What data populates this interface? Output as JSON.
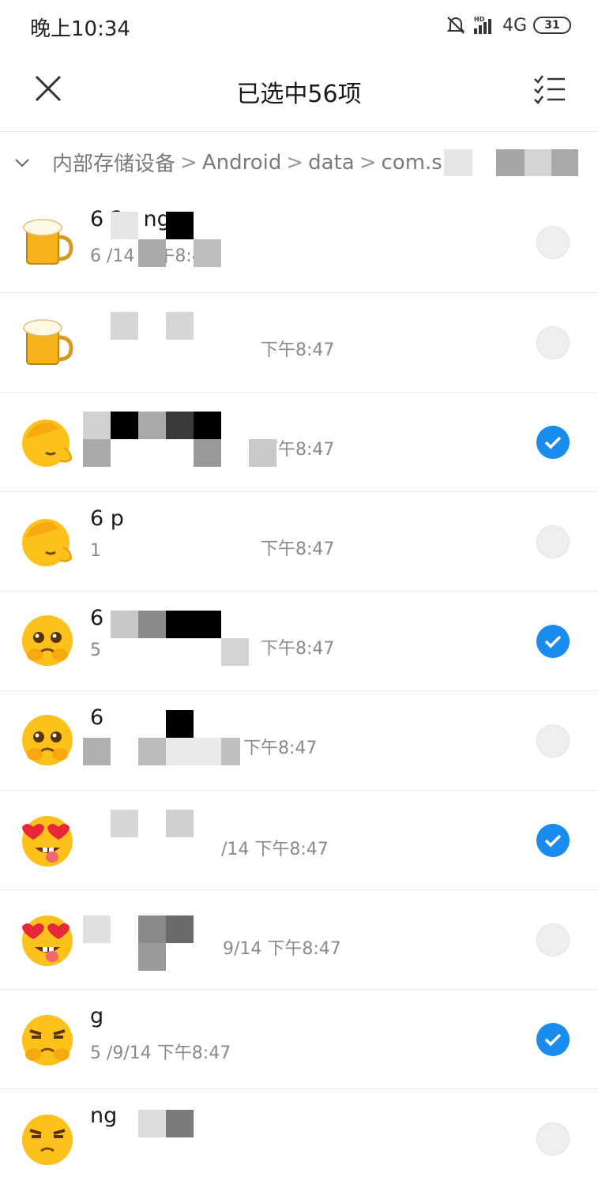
{
  "status_bar": {
    "time": "晚上10:34",
    "network": "4G",
    "battery": "31"
  },
  "header": {
    "title": "已选中56项"
  },
  "breadcrumb": {
    "segments": [
      "内部存储设备",
      "Android",
      "data",
      "com.s"
    ]
  },
  "rows": [
    {
      "name": "6    2y  ng",
      "meta": "6            /14 下午8:47",
      "emoji": "beer-icon",
      "selected": false
    },
    {
      "name": "",
      "meta": "下午8:47",
      "emoji": "beer-icon",
      "selected": false
    },
    {
      "name": "",
      "meta": "下午8:47",
      "emoji": "facepalm-icon",
      "selected": true
    },
    {
      "name": "6       p",
      "meta": "1",
      "meta_time": "下午8:47",
      "emoji": "facepalm-icon",
      "selected": false
    },
    {
      "name": "6",
      "meta": "5",
      "meta_time": "下午8:47",
      "emoji": "pleading-icon",
      "selected": true
    },
    {
      "name": "6",
      "meta": "",
      "meta_time": "下午8:47",
      "emoji": "pleading-icon",
      "selected": false
    },
    {
      "name": "",
      "meta": "/14 下午8:47",
      "emoji": "heart-eyes-icon",
      "selected": true
    },
    {
      "name": "",
      "meta": "9/14 下午8:47",
      "emoji": "heart-eyes-icon",
      "selected": false
    },
    {
      "name": "      g",
      "meta": "5          /9/14 下午8:47",
      "emoji": "smirk-icon",
      "selected": true
    },
    {
      "name": "        ng",
      "meta": "",
      "emoji": "smirk-icon",
      "selected": false
    }
  ]
}
